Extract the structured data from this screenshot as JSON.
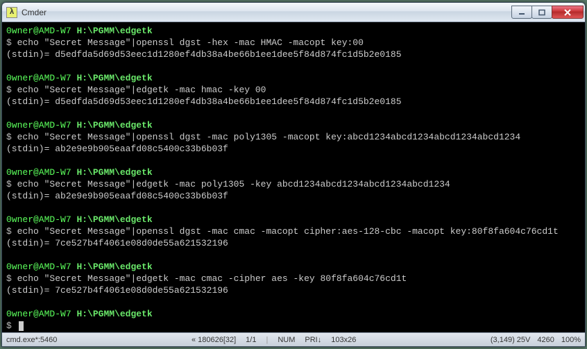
{
  "window": {
    "icon_glyph": "λ",
    "title": "Cmder"
  },
  "prompt": {
    "user": "0wner@AMD-W7",
    "path": "H:\\PGMM\\edgetk"
  },
  "blocks": [
    {
      "cmd": "echo \"Secret Message\"|openssl dgst -hex -mac HMAC -macopt key:00",
      "out": "(stdin)= d5edfda5d69d53eec1d1280ef4db38a4be66b1ee1dee5f84d874fc1d5b2e0185"
    },
    {
      "cmd": "echo \"Secret Message\"|edgetk -mac hmac -key 00",
      "out": "(stdin)= d5edfda5d69d53eec1d1280ef4db38a4be66b1ee1dee5f84d874fc1d5b2e0185"
    },
    {
      "cmd": "echo \"Secret Message\"|openssl dgst -mac poly1305 -macopt key:abcd1234abcd1234abcd1234abcd1234",
      "out": "(stdin)= ab2e9e9b905eaafd08c5400c33b6b03f"
    },
    {
      "cmd": "echo \"Secret Message\"|edgetk -mac poly1305 -key abcd1234abcd1234abcd1234abcd1234",
      "out": "(stdin)= ab2e9e9b905eaafd08c5400c33b6b03f"
    },
    {
      "cmd": "echo \"Secret Message\"|openssl dgst -mac cmac -macopt cipher:aes-128-cbc -macopt key:80f8fa604c76cd1t",
      "out": "(stdin)= 7ce527b4f4061e08d0de55a621532196"
    },
    {
      "cmd": "echo \"Secret Message\"|edgetk -mac cmac -cipher aes -key 80f8fa604c76cd1t",
      "out": "(stdin)= 7ce527b4f4061e08d0de55a621532196"
    }
  ],
  "status": {
    "proc": "cmd.exe*:5460",
    "buf": "« 180626[32]",
    "frac": "1/1",
    "num": "NUM",
    "pri": "PRI↓",
    "size": "103x26",
    "pos": "(3,149) 25V",
    "cols": "4260",
    "pct": "100%"
  }
}
